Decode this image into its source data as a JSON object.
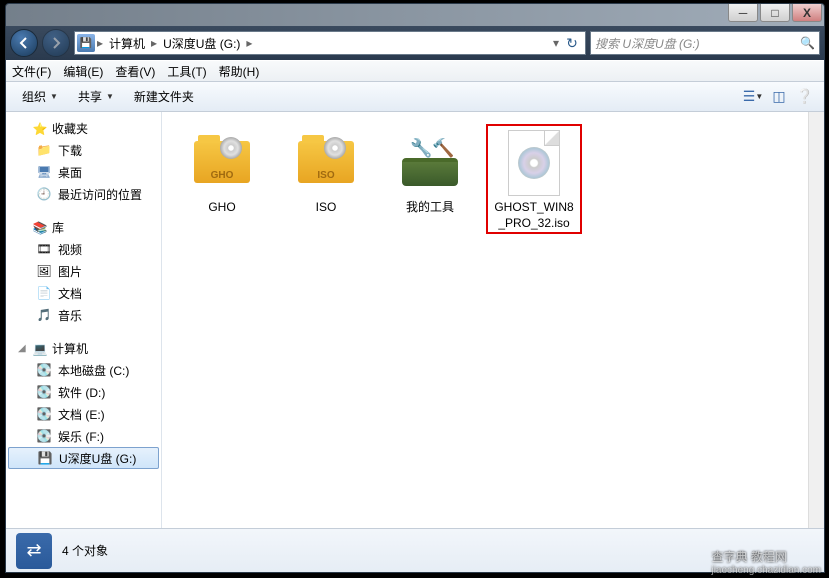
{
  "title_buttons": {
    "min": "─",
    "max": "□",
    "close": "X"
  },
  "breadcrumb": {
    "seg1": "计算机",
    "seg2": "U深度U盘 (G:)"
  },
  "search": {
    "placeholder": "搜索 U深度U盘 (G:)"
  },
  "menu": {
    "file": "文件(F)",
    "edit": "编辑(E)",
    "view": "查看(V)",
    "tools": "工具(T)",
    "help": "帮助(H)"
  },
  "toolbar": {
    "organize": "组织",
    "share": "共享",
    "newfolder": "新建文件夹"
  },
  "sidebar": {
    "fav": {
      "head": "收藏夹",
      "downloads": "下载",
      "desktop": "桌面",
      "recent": "最近访问的位置"
    },
    "lib": {
      "head": "库",
      "video": "视频",
      "pictures": "图片",
      "docs": "文档",
      "music": "音乐"
    },
    "pc": {
      "head": "计算机",
      "c": "本地磁盘 (C:)",
      "d": "软件 (D:)",
      "e": "文档 (E:)",
      "f": "娱乐 (F:)",
      "g": "U深度U盘 (G:)"
    }
  },
  "files": {
    "gho": "GHO",
    "iso": "ISO",
    "tools": "我的工具",
    "ghost": "GHOST_WIN8_PRO_32.iso"
  },
  "status": {
    "count": "4 个对象"
  },
  "watermark": {
    "line1": "查字典 教程网",
    "line2": "jiaocheng.chazidian.com"
  }
}
